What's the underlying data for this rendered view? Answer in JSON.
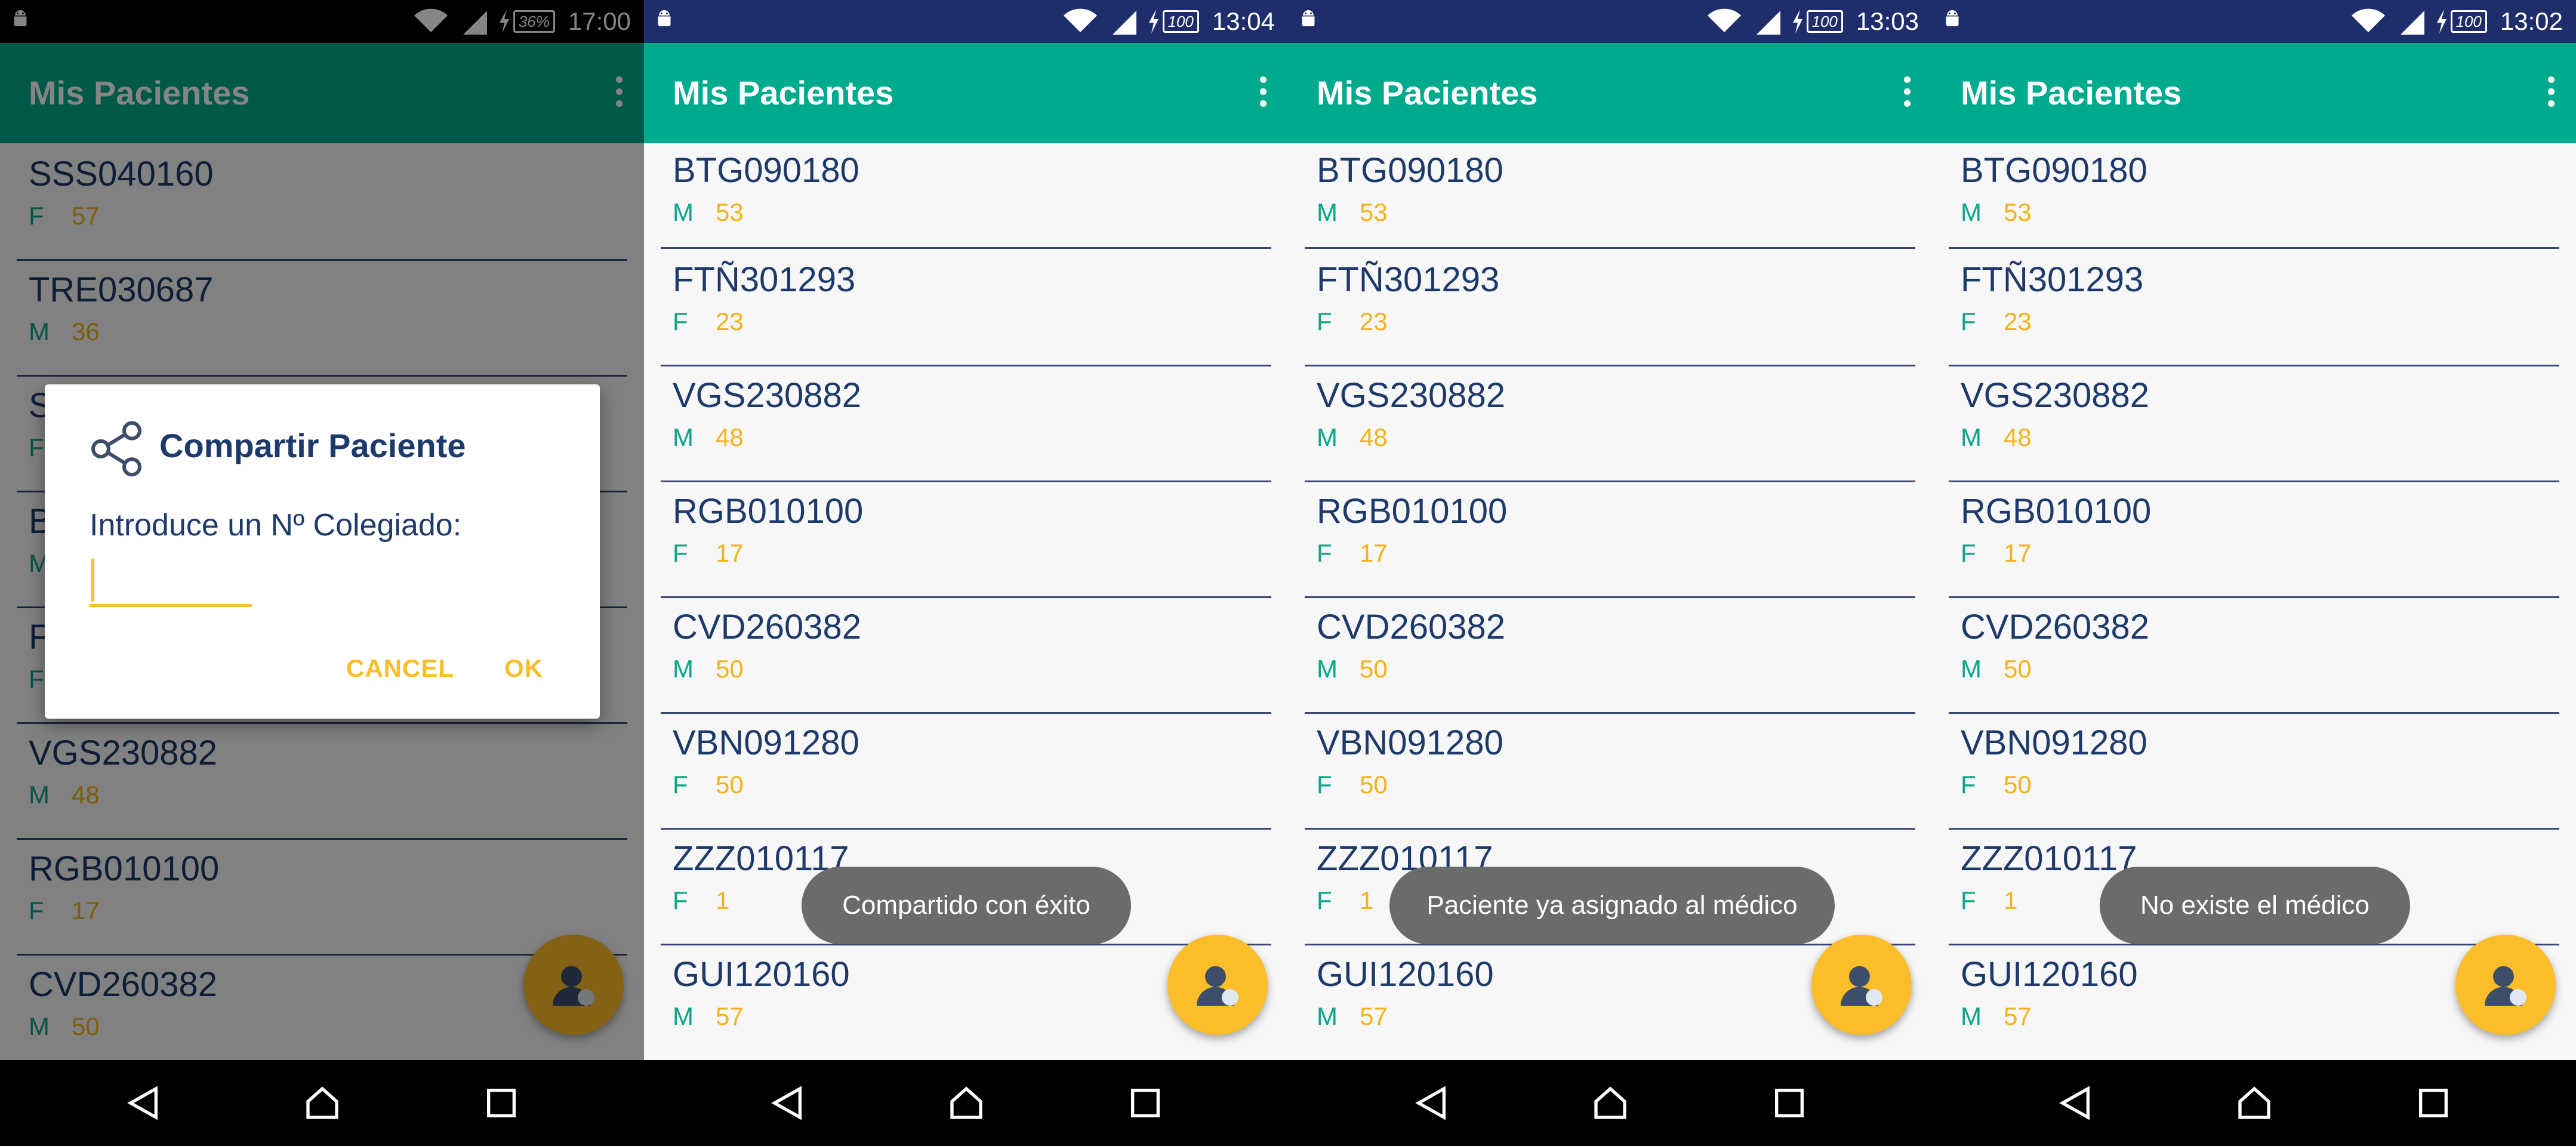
{
  "screens": [
    {
      "status": {
        "battery": "36%",
        "time": "17:00"
      },
      "app_title": "Mis Pacientes",
      "patients": [
        {
          "code": "SSS040160",
          "sex": "F",
          "age": "57"
        },
        {
          "code": "TRE030687",
          "sex": "M",
          "age": "36"
        },
        {
          "code": "S",
          "sex": "F",
          "age": ""
        },
        {
          "code": "B",
          "sex": "M",
          "age": ""
        },
        {
          "code": "F",
          "sex": "F",
          "age": ""
        },
        {
          "code": "VGS230882",
          "sex": "M",
          "age": "48"
        },
        {
          "code": "RGB010100",
          "sex": "F",
          "age": "17"
        },
        {
          "code": "CVD260382",
          "sex": "M",
          "age": "50"
        }
      ],
      "dialog": {
        "title": "Compartir Paciente",
        "prompt": "Introduce un Nº Colegiado:",
        "input_value": "",
        "cancel_label": "CANCEL",
        "ok_label": "OK"
      }
    },
    {
      "status": {
        "battery": "100",
        "time": "13:04"
      },
      "app_title": "Mis Pacientes",
      "patients": [
        {
          "code": "BTG090180",
          "sex": "M",
          "age": "53"
        },
        {
          "code": "FTÑ301293",
          "sex": "F",
          "age": "23"
        },
        {
          "code": "VGS230882",
          "sex": "M",
          "age": "48"
        },
        {
          "code": "RGB010100",
          "sex": "F",
          "age": "17"
        },
        {
          "code": "CVD260382",
          "sex": "M",
          "age": "50"
        },
        {
          "code": "VBN091280",
          "sex": "F",
          "age": "50"
        },
        {
          "code": "ZZZ010117",
          "sex": "F",
          "age": "1"
        },
        {
          "code": "GUI120160",
          "sex": "M",
          "age": "57"
        }
      ],
      "toast": "Compartido con éxito"
    },
    {
      "status": {
        "battery": "100",
        "time": "13:03"
      },
      "app_title": "Mis Pacientes",
      "patients": [
        {
          "code": "BTG090180",
          "sex": "M",
          "age": "53"
        },
        {
          "code": "FTÑ301293",
          "sex": "F",
          "age": "23"
        },
        {
          "code": "VGS230882",
          "sex": "M",
          "age": "48"
        },
        {
          "code": "RGB010100",
          "sex": "F",
          "age": "17"
        },
        {
          "code": "CVD260382",
          "sex": "M",
          "age": "50"
        },
        {
          "code": "VBN091280",
          "sex": "F",
          "age": "50"
        },
        {
          "code": "ZZZ010117",
          "sex": "F",
          "age": "1"
        },
        {
          "code": "GUI120160",
          "sex": "M",
          "age": "57"
        }
      ],
      "toast": "Paciente ya asignado al médico"
    },
    {
      "status": {
        "battery": "100",
        "time": "13:02"
      },
      "app_title": "Mis Pacientes",
      "patients": [
        {
          "code": "BTG090180",
          "sex": "M",
          "age": "53"
        },
        {
          "code": "FTÑ301293",
          "sex": "F",
          "age": "23"
        },
        {
          "code": "VGS230882",
          "sex": "M",
          "age": "48"
        },
        {
          "code": "RGB010100",
          "sex": "F",
          "age": "17"
        },
        {
          "code": "CVD260382",
          "sex": "M",
          "age": "50"
        },
        {
          "code": "VBN091280",
          "sex": "F",
          "age": "50"
        },
        {
          "code": "ZZZ010117",
          "sex": "F",
          "age": "1"
        },
        {
          "code": "GUI120160",
          "sex": "M",
          "age": "57"
        }
      ],
      "toast": "No existe el médico"
    }
  ],
  "colors": {
    "app_bar": "#00aa8c",
    "accent": "#fbbd2a",
    "text_primary": "#1e3a6a",
    "sex_text": "#0aa58a",
    "age_text": "#f2b31a",
    "toast_bg": "#6b6b6b"
  },
  "icons": {
    "status_left": "android-icon",
    "status_right": [
      "wifi-icon",
      "signal-icon",
      "battery-charging-icon"
    ],
    "app_bar_menu": "more-vert-icon",
    "fab": "share-user-icon",
    "dialog": "share-icon",
    "nav": [
      "back-icon",
      "home-icon",
      "recent-apps-icon"
    ]
  }
}
